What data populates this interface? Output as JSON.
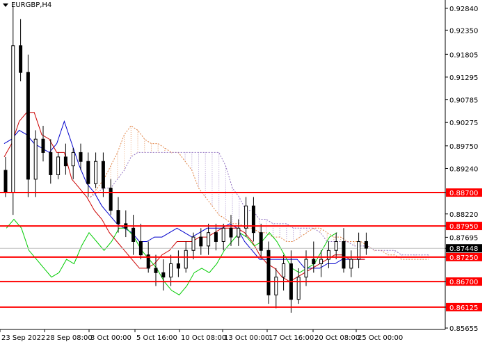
{
  "window": {
    "symbol_title": "EURGBP,H4"
  },
  "chart_data": {
    "type": "candlestick",
    "instrument": "EURGBP",
    "timeframe": "H4",
    "y_ticks": [
      "0.92840",
      "0.92350",
      "0.91805",
      "0.91295",
      "0.90785",
      "0.90275",
      "0.89750",
      "0.89240",
      "0.88700",
      "0.88220",
      "0.87950",
      "0.87695",
      "0.87448",
      "0.87250",
      "0.86700",
      "0.86125",
      "0.85655"
    ],
    "x_ticks": [
      "23 Sep 2022",
      "28 Sep 08:00",
      "3 Oct 00:00",
      "5 Oct 16:00",
      "10 Oct 08:00",
      "13 Oct 00:00",
      "17 Oct 16:00",
      "20 Oct 08:00",
      "25 Oct 00:00"
    ],
    "ylim": [
      0.85655,
      0.9284
    ],
    "current_price": "0.87448",
    "levels": [
      {
        "label": "0.88700",
        "value": 0.887
      },
      {
        "label": "0.87950",
        "value": 0.8795
      },
      {
        "label": "0.87250",
        "value": 0.8725
      },
      {
        "label": "0.86700",
        "value": 0.867
      },
      {
        "label": "0.86125",
        "value": 0.86125
      }
    ],
    "candles": [
      [
        0.892,
        0.895,
        0.886,
        0.887
      ],
      [
        0.887,
        0.929,
        0.882,
        0.92
      ],
      [
        0.92,
        0.926,
        0.912,
        0.914
      ],
      [
        0.914,
        0.918,
        0.886,
        0.89
      ],
      [
        0.89,
        0.901,
        0.886,
        0.899
      ],
      [
        0.899,
        0.902,
        0.894,
        0.896
      ],
      [
        0.896,
        0.899,
        0.889,
        0.891
      ],
      [
        0.891,
        0.896,
        0.89,
        0.895
      ],
      [
        0.895,
        0.898,
        0.891,
        0.893
      ],
      [
        0.893,
        0.897,
        0.89,
        0.896
      ],
      [
        0.896,
        0.898,
        0.892,
        0.894
      ],
      [
        0.894,
        0.896,
        0.886,
        0.889
      ],
      [
        0.889,
        0.896,
        0.888,
        0.894
      ],
      [
        0.894,
        0.896,
        0.886,
        0.888
      ],
      [
        0.888,
        0.89,
        0.882,
        0.883
      ],
      [
        0.883,
        0.886,
        0.878,
        0.88
      ],
      [
        0.88,
        0.883,
        0.877,
        0.879
      ],
      [
        0.879,
        0.882,
        0.873,
        0.876
      ],
      [
        0.876,
        0.88,
        0.872,
        0.873
      ],
      [
        0.873,
        0.876,
        0.869,
        0.87
      ],
      [
        0.87,
        0.873,
        0.866,
        0.869
      ],
      [
        0.869,
        0.872,
        0.865,
        0.868
      ],
      [
        0.868,
        0.873,
        0.866,
        0.871
      ],
      [
        0.871,
        0.874,
        0.868,
        0.87
      ],
      [
        0.87,
        0.876,
        0.869,
        0.874
      ],
      [
        0.874,
        0.878,
        0.872,
        0.877
      ],
      [
        0.877,
        0.879,
        0.873,
        0.875
      ],
      [
        0.875,
        0.88,
        0.873,
        0.878
      ],
      [
        0.878,
        0.88,
        0.874,
        0.876
      ],
      [
        0.876,
        0.88,
        0.874,
        0.879
      ],
      [
        0.879,
        0.882,
        0.875,
        0.877
      ],
      [
        0.877,
        0.881,
        0.875,
        0.879
      ],
      [
        0.879,
        0.886,
        0.877,
        0.884
      ],
      [
        0.884,
        0.886,
        0.876,
        0.878
      ],
      [
        0.878,
        0.88,
        0.872,
        0.874
      ],
      [
        0.874,
        0.876,
        0.862,
        0.864
      ],
      [
        0.864,
        0.87,
        0.861,
        0.868
      ],
      [
        0.868,
        0.873,
        0.865,
        0.871
      ],
      [
        0.871,
        0.874,
        0.86,
        0.863
      ],
      [
        0.863,
        0.87,
        0.862,
        0.868
      ],
      [
        0.868,
        0.874,
        0.866,
        0.872
      ],
      [
        0.872,
        0.876,
        0.869,
        0.871
      ],
      [
        0.871,
        0.874,
        0.868,
        0.872
      ],
      [
        0.872,
        0.876,
        0.87,
        0.874
      ],
      [
        0.874,
        0.878,
        0.872,
        0.876
      ],
      [
        0.876,
        0.879,
        0.869,
        0.87
      ],
      [
        0.87,
        0.874,
        0.868,
        0.872
      ],
      [
        0.872,
        0.878,
        0.87,
        0.876
      ],
      [
        0.876,
        0.878,
        0.873,
        0.8745
      ]
    ],
    "series": [
      {
        "name": "tenkan",
        "color": "#0000cc",
        "values": [
          0.898,
          0.899,
          0.901,
          0.9,
          0.898,
          0.897,
          0.896,
          0.898,
          0.903,
          0.898,
          0.893,
          0.889,
          0.887,
          0.884,
          0.882,
          0.88,
          0.879,
          0.878,
          0.876,
          0.876,
          0.877,
          0.877,
          0.878,
          0.879,
          0.878,
          0.877,
          0.878,
          0.879,
          0.879,
          0.879,
          0.88,
          0.879,
          0.876,
          0.874,
          0.872,
          0.872,
          0.872,
          0.872,
          0.872,
          0.872,
          0.87,
          0.87,
          0.87,
          0.871,
          0.871,
          0.872,
          0.872,
          0.872,
          0.872
        ]
      },
      {
        "name": "kijun",
        "color": "#cc0000",
        "values": [
          0.895,
          0.898,
          0.903,
          0.905,
          0.905,
          0.9,
          0.899,
          0.896,
          0.896,
          0.89,
          0.888,
          0.886,
          0.883,
          0.881,
          0.878,
          0.876,
          0.874,
          0.872,
          0.87,
          0.87,
          0.871,
          0.873,
          0.874,
          0.876,
          0.876,
          0.876,
          0.877,
          0.877,
          0.878,
          0.879,
          0.879,
          0.879,
          0.878,
          0.876,
          0.873,
          0.871,
          0.87,
          0.868,
          0.867,
          0.868,
          0.869,
          0.87,
          0.871,
          0.872,
          0.873,
          0.873,
          0.872,
          0.872,
          0.872
        ]
      },
      {
        "name": "chikou",
        "color": "#00cc00",
        "values": [
          0.879,
          0.881,
          0.879,
          0.874,
          0.872,
          0.87,
          0.868,
          0.869,
          0.872,
          0.871,
          0.875,
          0.878,
          0.876,
          0.874,
          0.876,
          0.879,
          0.879,
          0.877,
          0.874,
          0.872,
          0.87,
          0.867,
          0.865,
          0.864,
          0.866,
          0.869,
          0.87,
          0.869,
          0.871,
          0.874,
          0.876,
          0.878,
          0.877,
          0.875,
          0.876,
          0.878,
          0.876,
          0.873,
          0.87,
          0.869,
          0.87,
          0.871,
          0.874,
          0.877,
          0.878
        ]
      },
      {
        "name": "span_a",
        "color": "#e08040",
        "values": [
          0.886,
          0.888,
          0.89,
          0.893,
          0.896,
          0.9,
          0.902,
          0.901,
          0.899,
          0.898,
          0.898,
          0.897,
          0.896,
          0.896,
          0.894,
          0.892,
          0.888,
          0.886,
          0.884,
          0.882,
          0.881,
          0.88,
          0.88,
          0.879,
          0.879,
          0.878,
          0.878,
          0.877,
          0.877,
          0.876,
          0.876,
          0.877,
          0.878,
          0.879,
          0.879,
          0.878,
          0.877,
          0.877,
          0.876,
          0.876,
          0.876,
          0.875,
          0.874,
          0.874,
          0.873,
          0.873,
          0.872,
          0.872,
          0.872,
          0.872,
          0.872,
          0.873,
          0.873,
          0.873,
          0.872,
          0.871
        ]
      },
      {
        "name": "span_b",
        "color": "#9070c0",
        "values": [
          0.886,
          0.887,
          0.888,
          0.888,
          0.89,
          0.892,
          0.895,
          0.896,
          0.896,
          0.896,
          0.896,
          0.896,
          0.896,
          0.896,
          0.896,
          0.896,
          0.896,
          0.896,
          0.896,
          0.896,
          0.893,
          0.888,
          0.886,
          0.883,
          0.883,
          0.881,
          0.881,
          0.88,
          0.88,
          0.88,
          0.879,
          0.879,
          0.879,
          0.879,
          0.878,
          0.876,
          0.876,
          0.876,
          0.876,
          0.875,
          0.875,
          0.875,
          0.874,
          0.874,
          0.874,
          0.874,
          0.873,
          0.873,
          0.873,
          0.873,
          0.873,
          0.873,
          0.873,
          0.873,
          0.873,
          0.873
        ]
      }
    ],
    "colors": {
      "bull_body": "#ffffff",
      "bear_body": "#000000",
      "candle_outline": "#000000",
      "level_line": "#ff0000",
      "level_label_bg": "#ff0000",
      "level_label_text": "#ffffff",
      "price_label_bg": "#000000",
      "price_label_text": "#ffffff",
      "price_line": "#c0c0c0",
      "axis": "#000000"
    }
  }
}
